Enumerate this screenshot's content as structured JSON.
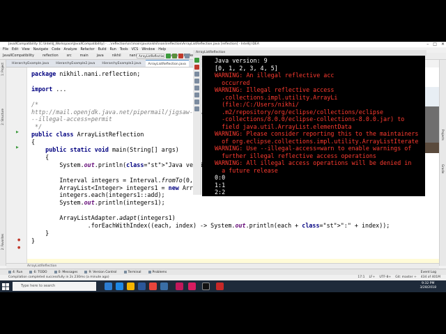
{
  "ide": {
    "title": "JavaXCompatibility [C:\\IntelliJ_Workspace\\JavaXCompatibility] - ...\\reflection\\src\\main\\java\\nikhil\\nani\\reflection\\ArrayListReflection.java [reflection] - IntelliJ IDEA",
    "menu": [
      "File",
      "Edit",
      "View",
      "Navigate",
      "Code",
      "Analyze",
      "Refactor",
      "Build",
      "Run",
      "Tools",
      "VCS",
      "Window",
      "Help"
    ],
    "breadcrumbs": [
      "JavaXCompatibility",
      "reflection",
      "src",
      "main",
      "java",
      "nikhil",
      "nani",
      "reflection",
      "ArrayListReflection"
    ],
    "run_config": "ArrayListReflection",
    "tabs": [
      "HierarchyExample.java",
      "HierarchyExample2.java",
      "HierarchyExample3.java",
      "ArrayListReflection.java"
    ],
    "left_tool_labels": [
      "1: Project",
      "2: Structure",
      "2: Favorites"
    ],
    "right_tool_labels": [
      "Projects",
      "Gradle"
    ],
    "status_bar_run_label": "ArrayListReflection"
  },
  "editor": {
    "lines": [
      "package nikhil.nani.reflection;",
      "",
      "import ...",
      "",
      "/*",
      "http://mail.openjdk.java.net/pipermail/jigsaw-dev/...",
      "--illegal-access=permit",
      " */",
      "public class ArrayListReflection",
      "{",
      "    public static void main(String[] args)",
      "    {",
      "        System.out.println(\"Java version: \" + S",
      "",
      "        Interval integers = Interval.fromTo(0,",
      "        ArrayList<Integer> integers1 = new Arra",
      "        integers.each(integers1::add);",
      "        System.out.println(integers1);",
      "",
      "        ArrayListAdapter.adapt(integers1)",
      "                .forEachWithIndex((each, index) -> System.out.println(each + \":\" + index));",
      "    }",
      "}"
    ]
  },
  "console": {
    "title": "ArrayListReflection",
    "lines": [
      {
        "text": "Java version: 9",
        "kind": "out"
      },
      {
        "text": "[0, 1, 2, 3, 4, 5]",
        "kind": "out"
      },
      {
        "text": "WARNING: An illegal reflective acc",
        "kind": "err"
      },
      {
        "text": "  occurred",
        "kind": "err"
      },
      {
        "text": "WARNING: Illegal reflective access",
        "kind": "err"
      },
      {
        "text": "  .collections.impl.utility.ArrayLi",
        "kind": "err"
      },
      {
        "text": "  (file:/C:/Users/nikhi/",
        "kind": "err"
      },
      {
        "text": "  .m2/repository/org/eclipse/collections/eclipse",
        "kind": "err"
      },
      {
        "text": "  -collections/8.0.0/eclipse-collections-8.0.0.jar) to",
        "kind": "err"
      },
      {
        "text": "  field java.util.ArrayList.elementData",
        "kind": "err"
      },
      {
        "text": "WARNING: Please consider reporting this to the maintainers",
        "kind": "err"
      },
      {
        "text": "  of org.eclipse.collections.impl.utility.ArrayListIterate",
        "kind": "err"
      },
      {
        "text": "WARNING: Use --illegal-access=warn to enable warnings of",
        "kind": "err"
      },
      {
        "text": "  further illegal reflective access operations",
        "kind": "err"
      },
      {
        "text": "WARNING: All illegal access operations will be denied in",
        "kind": "err"
      },
      {
        "text": "  a future release",
        "kind": "err"
      },
      {
        "text": "0:0",
        "kind": "out"
      },
      {
        "text": "1:1",
        "kind": "out"
      },
      {
        "text": "2:2",
        "kind": "out"
      }
    ]
  },
  "toolwindows": [
    "4: Run",
    "6: TODO",
    "0: Messages",
    "9: Version Control",
    "Terminal",
    "Problems"
  ],
  "event_log": "Event Log",
  "status": {
    "message": "Compilation completed successfully in 2s 230ms (a minute ago)",
    "position": "17:1",
    "line_sep": "LF÷",
    "encoding": "UTF-8÷",
    "vcs": "Git: master ÷",
    "memory": "434 of 401M"
  },
  "taskbar": {
    "search_placeholder": "Type here to search",
    "time": "9:32 PM",
    "date": "3/28/2018"
  },
  "colors": {
    "console_bg": "#000000",
    "console_out": "#ffffff",
    "console_err": "#ff3b30",
    "keyword": "#000080",
    "string": "#008000",
    "comment": "#808080",
    "caret_line": "#fffbd7",
    "taskbar": "#1e2a3a"
  }
}
